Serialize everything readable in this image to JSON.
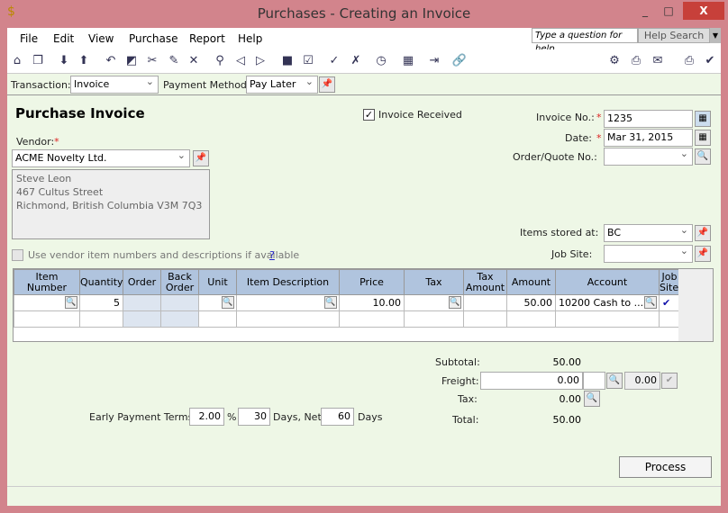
{
  "window": {
    "title": "Purchases - Creating an Invoice",
    "minimize": "_",
    "maximize": "□",
    "close": "X"
  },
  "menu": [
    "File",
    "Edit",
    "View",
    "Purchase",
    "Report",
    "Help"
  ],
  "help": {
    "placeholder": "Type a question for help",
    "search": "Help Search"
  },
  "toolbar": {
    "icons": [
      "home-icon",
      "copy-icon",
      "download-icon",
      "upload-icon",
      "undo-icon",
      "adjust-icon",
      "remove-icon",
      "edit-icon",
      "delete-icon",
      "lookup-icon",
      "prev-icon",
      "next-icon",
      "fill-icon",
      "check-icon",
      "track-icon",
      "cancel-icon",
      "time-icon",
      "calculator-icon",
      "export-icon",
      "link-icon"
    ],
    "right_icons": [
      "settings-icon",
      "preview-icon",
      "email-icon",
      "print-icon",
      "checkmark-icon"
    ]
  },
  "transaction": {
    "label": "Transaction:",
    "value": "Invoice"
  },
  "payment": {
    "label": "Payment Method:",
    "value": "Pay Later"
  },
  "heading": "Purchase Invoice",
  "invoice_received": {
    "label": "Invoice Received",
    "checked": true
  },
  "vendor": {
    "label": "Vendor:",
    "value": "ACME Novelty Ltd.",
    "address": [
      "Steve Leon",
      "467 Cultus Street",
      "Richmond, British Columbia  V3M 7Q3"
    ]
  },
  "invoice_no": {
    "label": "Invoice No.:",
    "value": "1235"
  },
  "date": {
    "label": "Date:",
    "value": "Mar 31, 2015"
  },
  "order_quote": {
    "label": "Order/Quote No.:",
    "value": ""
  },
  "items_stored": {
    "label": "Items stored at:",
    "value": "BC"
  },
  "job_site": {
    "label": "Job Site:",
    "value": ""
  },
  "use_vendor": {
    "label": "Use vendor item numbers and descriptions if available",
    "help": "?"
  },
  "columns": [
    "Item Number",
    "Quantity",
    "Order",
    "Back Order",
    "Unit",
    "Item Description",
    "Price",
    "Tax",
    "Tax Amount",
    "Amount",
    "Account",
    "Job Sites"
  ],
  "rows": [
    {
      "item": "",
      "quantity": "5",
      "order": "",
      "back_order": "",
      "unit": "",
      "description": "",
      "price": "10.00",
      "tax": "",
      "tax_amount": "",
      "amount": "50.00",
      "account": "10200 Cash to ...",
      "job_sites": "✔"
    }
  ],
  "totals": {
    "subtotal_label": "Subtotal:",
    "subtotal": "50.00",
    "freight_label": "Freight:",
    "freight": "0.00",
    "freight_tax": "0.00",
    "tax_label": "Tax:",
    "tax": "0.00",
    "total_label": "Total:",
    "total": "50.00"
  },
  "terms": {
    "label": "Early Payment Terms:",
    "percent": "2.00",
    "pct_sign": "%",
    "days": "30",
    "days_label": "Days, Net",
    "net": "60",
    "net_label": "Days"
  },
  "process": "Process"
}
